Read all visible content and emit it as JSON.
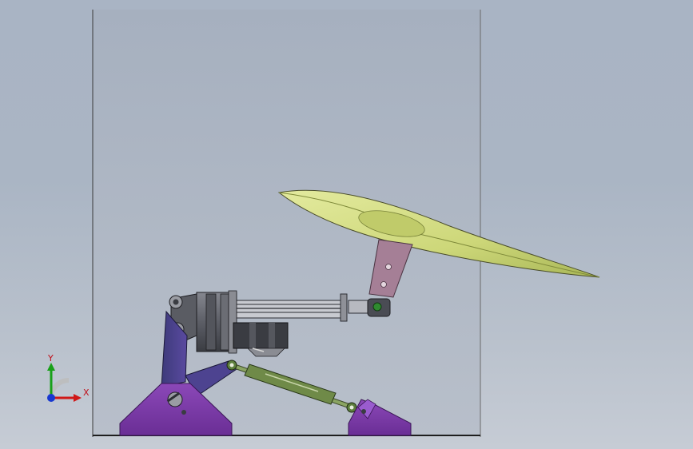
{
  "view": {
    "colors": {
      "background_top": "#a9b4c4",
      "background_bottom": "#c6ccd5",
      "frame_panel": "#aab3c1",
      "frame_edge": "#2a2a2a",
      "base_purple": "#7a3aa6",
      "base_purple_dark": "#4a1c6e",
      "wing": "#d6df8a",
      "wing_dark": "#9aa84a",
      "bracket_pink": "#a37e94",
      "actuator_gray": "#6e7078",
      "actuator_dark": "#2c2e34",
      "link_green": "#7e9a5a",
      "pin_green": "#2f8a2f"
    },
    "triad": {
      "x_label": "X",
      "y_label": "Y",
      "x_color": "#d01818",
      "y_color": "#18a018",
      "z_color": "#1838d0"
    }
  }
}
